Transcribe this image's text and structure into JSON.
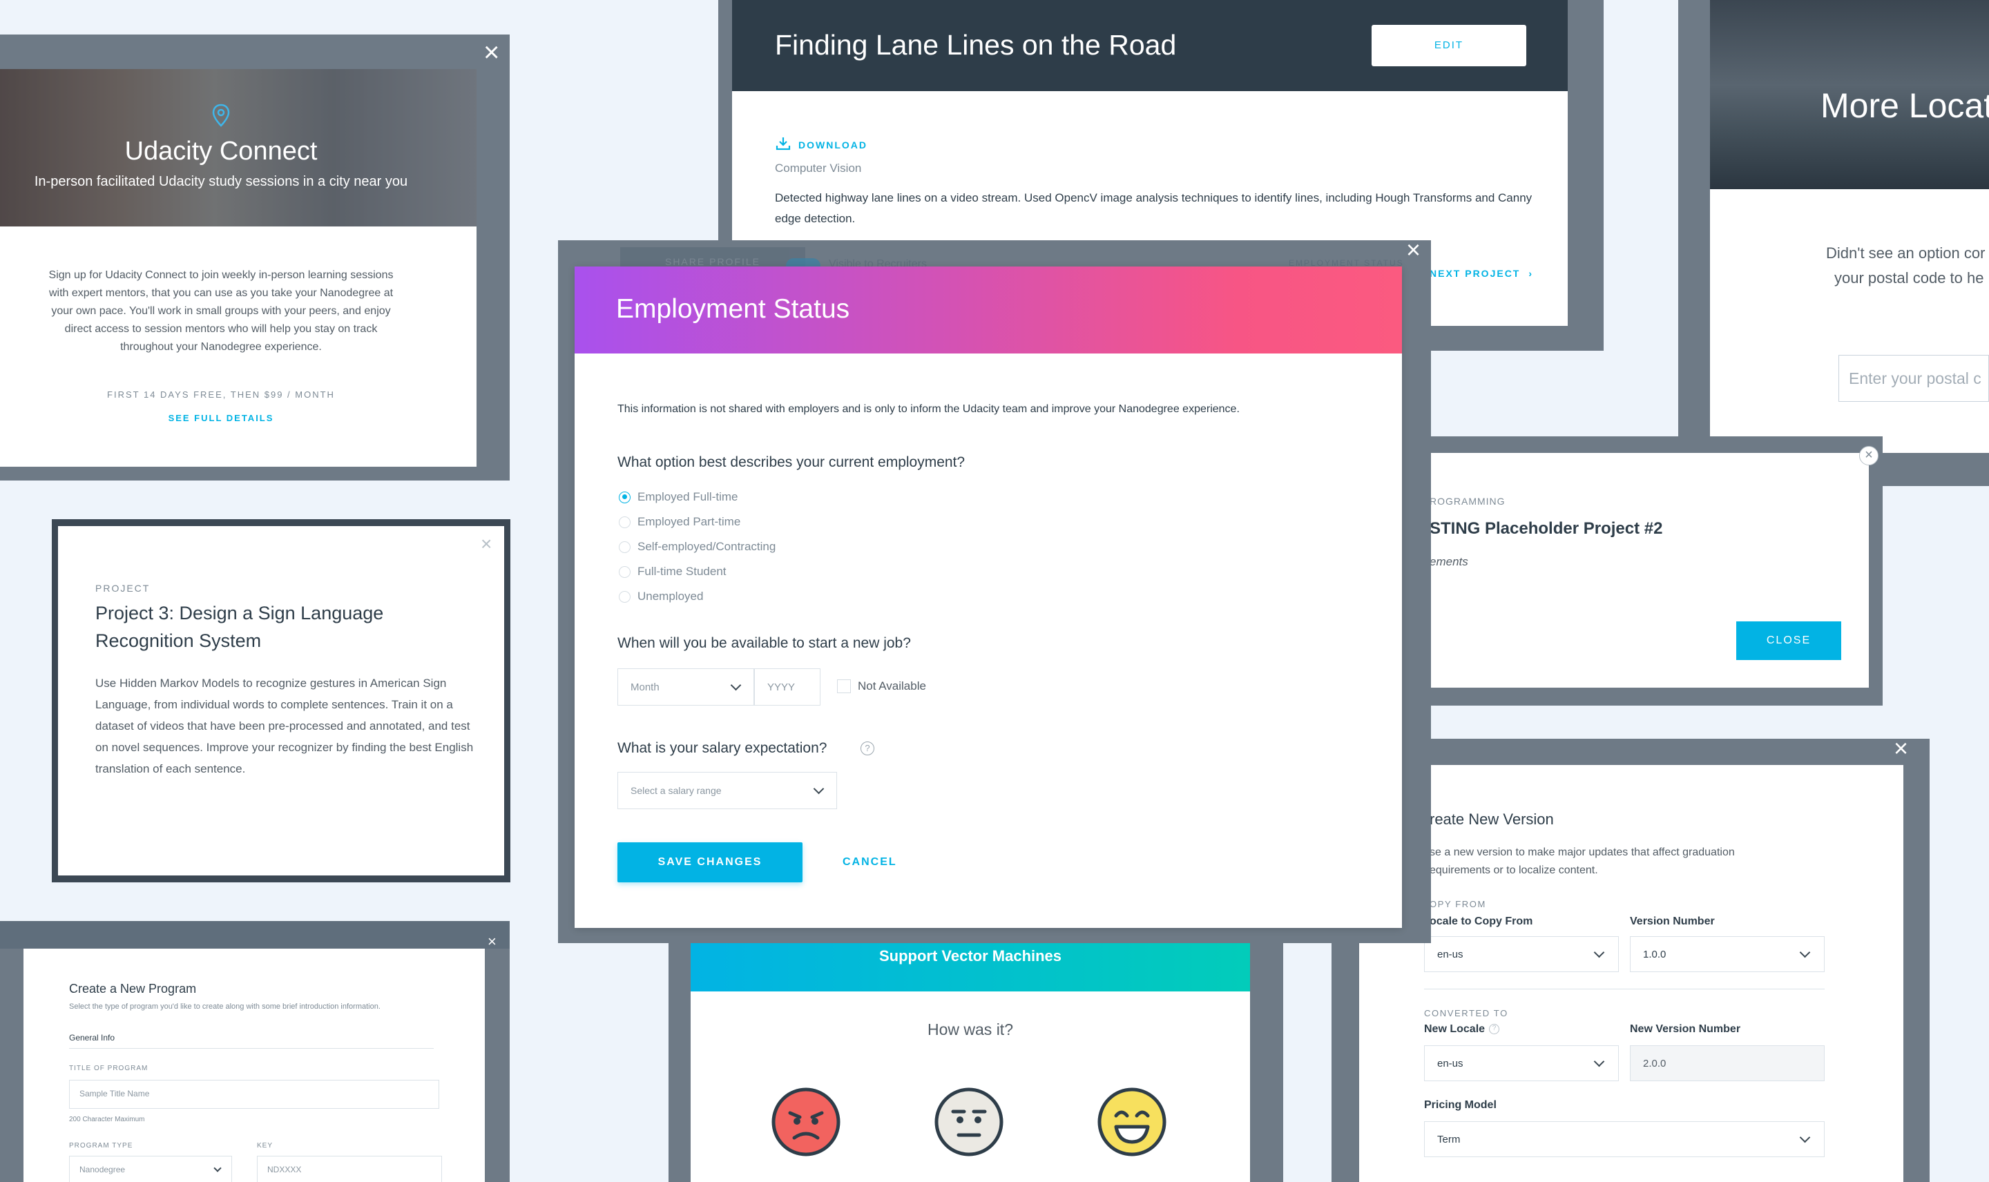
{
  "connect": {
    "title": "Udacity Connect",
    "subtitle": "In-person facilitated Udacity study sessions in a city near you",
    "body": "Sign up for Udacity Connect to join weekly in-person learning sessions with expert mentors, that you can use as you take your Nanodegree at your own pace. You'll work in small groups with your peers, and enjoy direct access to session mentors who will help you stay on track throughout your Nanodegree experience.",
    "price": "FIRST 14 DAYS FREE, THEN $99 / MONTH",
    "details": "SEE FULL DETAILS",
    "close": "×"
  },
  "lane": {
    "title": "Finding Lane Lines on the Road",
    "edit": "EDIT",
    "download": "DOWNLOAD",
    "category": "Computer Vision",
    "description": "Detected highway lane lines on a video stream. Used OpencV image analysis techniques to identify lines, including Hough Transforms and Canny edge detection.",
    "next": "NEXT PROJECT"
  },
  "locations": {
    "title": "More Locat",
    "text1": "Didn't see an option cor",
    "text2": "your postal code to he",
    "placeholder": "Enter your postal c"
  },
  "project": {
    "eyebrow": "PROJECT",
    "title": "Project 3: Design a Sign Language Recognition System",
    "body": "Use Hidden Markov Models to recognize gestures in American Sign Language, from individual words to complete sentences. Train it on a dataset of videos that have been pre-processed and annotated, and test on novel sequences. Improve your recognizer by finding the best English translation of each sentence.",
    "close": "×"
  },
  "employment": {
    "title": "Employment Status",
    "info": "This information is not shared with employers and is only to inform the Udacity team and improve your Nanodegree experience.",
    "q1": "What option best describes your current employment?",
    "options": [
      "Employed Full-time",
      "Employed Part-time",
      "Self-employed/Contracting",
      "Full-time Student",
      "Unemployed"
    ],
    "q2": "When will you be available to start a new job?",
    "month": "Month",
    "year": "YYYY",
    "not_available": "Not Available",
    "q3": "What is your salary expectation?",
    "salary_placeholder": "Select a salary range",
    "save": "SAVE CHANGES",
    "cancel": "CANCEL",
    "help": "?",
    "close": "×"
  },
  "behind": {
    "share": "SHARE PROFILE",
    "visible": "Visible to Recruiters",
    "status": "EMPLOYMENT STATUS"
  },
  "placeholder_modal": {
    "eyebrow": "ROGRAMMING",
    "title": "STING Placeholder Project #2",
    "sub": "ements",
    "close": "CLOSE",
    "x": "×"
  },
  "program": {
    "title": "Create a New Program",
    "subtitle": "Select the type of program you'd like to create along with some brief introduction information.",
    "tab": "General Info",
    "title_label": "TITLE OF PROGRAM",
    "title_placeholder": "Sample Title Name",
    "limit": "200 Character Maximum",
    "type_label": "PROGRAM TYPE",
    "type_value": "Nanodegree",
    "key_label": "KEY",
    "key_placeholder": "NDXXXX",
    "close": "×"
  },
  "svm": {
    "title": "Support Vector Machines",
    "question": "How was it?"
  },
  "version": {
    "title": "reate New Version",
    "desc": "se a new version to make major updates that affect graduation equirements or to localize content.",
    "copy_from": "OPY FROM",
    "locale_label": "ocale to Copy From",
    "locale_value": "en-us",
    "version_label": "Version Number",
    "version_value": "1.0.0",
    "converted": "CONVERTED TO",
    "new_locale_label": "New Locale",
    "new_locale_value": "en-us",
    "new_version_label": "New Version Number",
    "new_version_value": "2.0.0",
    "pricing_label": "Pricing Model",
    "pricing_value": "Term",
    "close": "×"
  }
}
